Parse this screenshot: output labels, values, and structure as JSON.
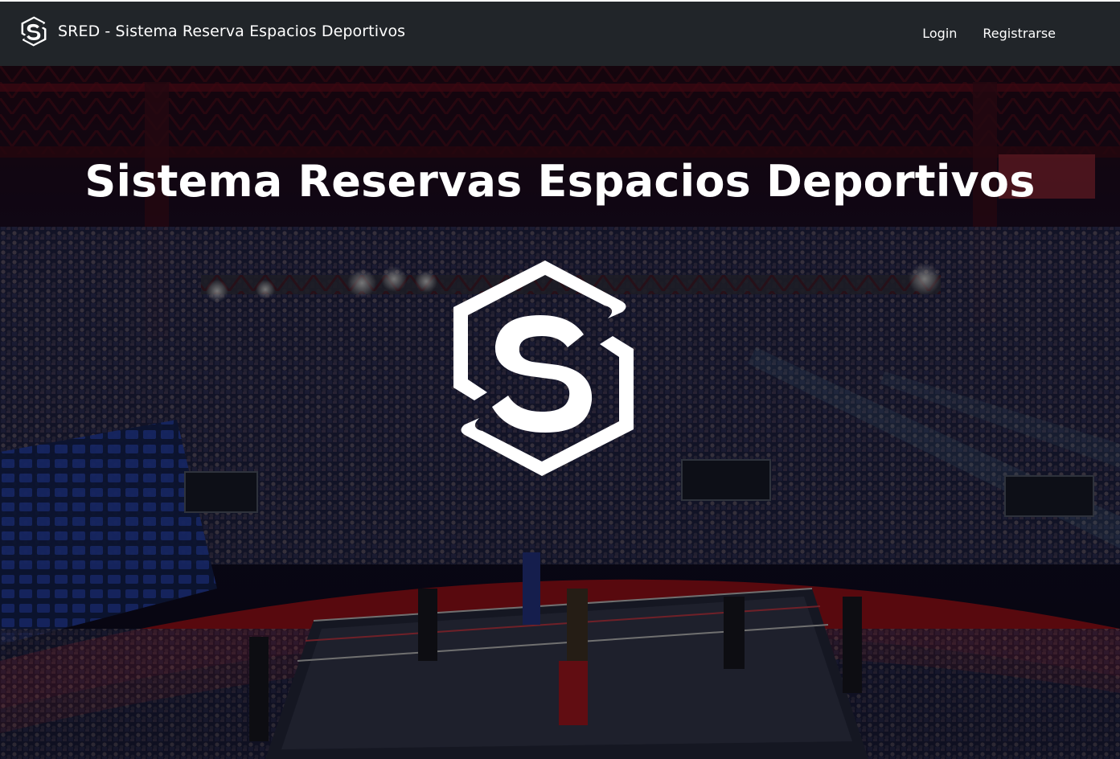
{
  "navbar": {
    "brand_text": "SRED - Sistema Reserva Espacios Deportivos",
    "brand_icon": "sred-logo-icon",
    "links": [
      {
        "label": "Login"
      },
      {
        "label": "Registrarse"
      }
    ],
    "background_color": "#212529"
  },
  "hero": {
    "title": "Sistema Reservas Espacios Deportivos",
    "logo_icon": "sred-logo-icon",
    "background_description_icon": "boxing-arena-photo",
    "accent_colors": {
      "ring_apron_red": "#c0141e",
      "seats_blue": "#1f3a9c",
      "overlay": "#000000"
    }
  }
}
